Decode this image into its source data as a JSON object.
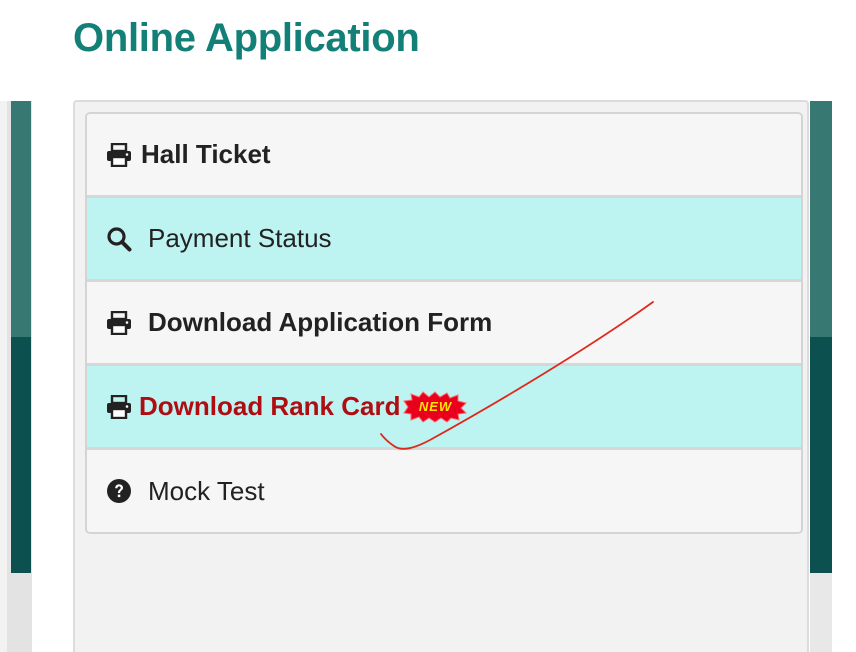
{
  "page": {
    "title": "Online Application"
  },
  "menu": {
    "items": [
      {
        "label": "Hall Ticket",
        "icon": "print-icon"
      },
      {
        "label": "Payment Status",
        "icon": "search-icon"
      },
      {
        "label": "Download Application Form",
        "icon": "print-icon"
      },
      {
        "label": "Download Rank Card",
        "icon": "print-icon",
        "badge": "NEW"
      },
      {
        "label": "Mock Test",
        "icon": "question-circle-icon"
      }
    ]
  },
  "colors": {
    "title": "#138078",
    "highlight_row": "#bdf3f1",
    "rank_card_text": "#b00d12",
    "badge_fill": "#e8001c",
    "badge_text": "#ffe600",
    "annotation": "#e0281c"
  }
}
